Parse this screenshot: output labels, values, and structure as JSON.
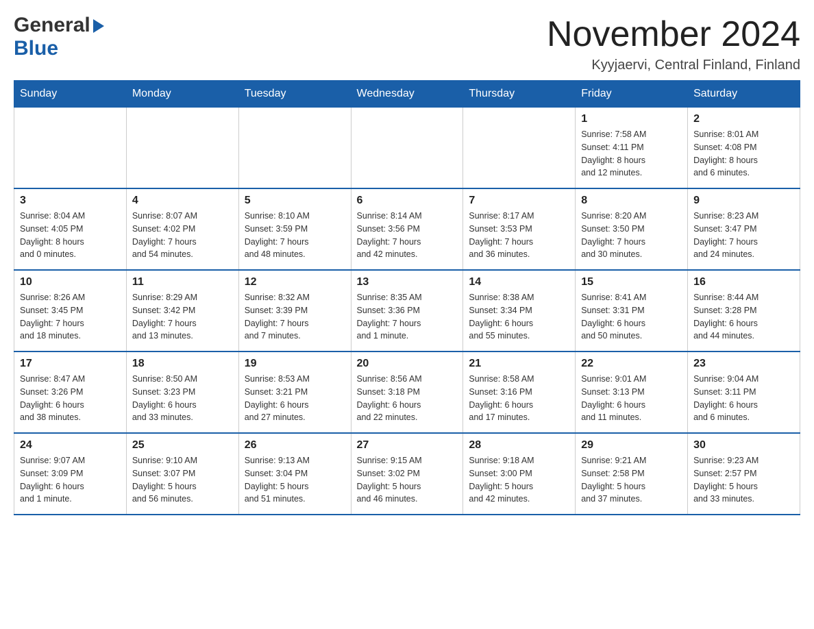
{
  "logo": {
    "general": "General",
    "blue": "Blue"
  },
  "title": "November 2024",
  "location": "Kyyjaervi, Central Finland, Finland",
  "weekdays": [
    "Sunday",
    "Monday",
    "Tuesday",
    "Wednesday",
    "Thursday",
    "Friday",
    "Saturday"
  ],
  "weeks": [
    [
      {
        "day": "",
        "info": ""
      },
      {
        "day": "",
        "info": ""
      },
      {
        "day": "",
        "info": ""
      },
      {
        "day": "",
        "info": ""
      },
      {
        "day": "",
        "info": ""
      },
      {
        "day": "1",
        "info": "Sunrise: 7:58 AM\nSunset: 4:11 PM\nDaylight: 8 hours\nand 12 minutes."
      },
      {
        "day": "2",
        "info": "Sunrise: 8:01 AM\nSunset: 4:08 PM\nDaylight: 8 hours\nand 6 minutes."
      }
    ],
    [
      {
        "day": "3",
        "info": "Sunrise: 8:04 AM\nSunset: 4:05 PM\nDaylight: 8 hours\nand 0 minutes."
      },
      {
        "day": "4",
        "info": "Sunrise: 8:07 AM\nSunset: 4:02 PM\nDaylight: 7 hours\nand 54 minutes."
      },
      {
        "day": "5",
        "info": "Sunrise: 8:10 AM\nSunset: 3:59 PM\nDaylight: 7 hours\nand 48 minutes."
      },
      {
        "day": "6",
        "info": "Sunrise: 8:14 AM\nSunset: 3:56 PM\nDaylight: 7 hours\nand 42 minutes."
      },
      {
        "day": "7",
        "info": "Sunrise: 8:17 AM\nSunset: 3:53 PM\nDaylight: 7 hours\nand 36 minutes."
      },
      {
        "day": "8",
        "info": "Sunrise: 8:20 AM\nSunset: 3:50 PM\nDaylight: 7 hours\nand 30 minutes."
      },
      {
        "day": "9",
        "info": "Sunrise: 8:23 AM\nSunset: 3:47 PM\nDaylight: 7 hours\nand 24 minutes."
      }
    ],
    [
      {
        "day": "10",
        "info": "Sunrise: 8:26 AM\nSunset: 3:45 PM\nDaylight: 7 hours\nand 18 minutes."
      },
      {
        "day": "11",
        "info": "Sunrise: 8:29 AM\nSunset: 3:42 PM\nDaylight: 7 hours\nand 13 minutes."
      },
      {
        "day": "12",
        "info": "Sunrise: 8:32 AM\nSunset: 3:39 PM\nDaylight: 7 hours\nand 7 minutes."
      },
      {
        "day": "13",
        "info": "Sunrise: 8:35 AM\nSunset: 3:36 PM\nDaylight: 7 hours\nand 1 minute."
      },
      {
        "day": "14",
        "info": "Sunrise: 8:38 AM\nSunset: 3:34 PM\nDaylight: 6 hours\nand 55 minutes."
      },
      {
        "day": "15",
        "info": "Sunrise: 8:41 AM\nSunset: 3:31 PM\nDaylight: 6 hours\nand 50 minutes."
      },
      {
        "day": "16",
        "info": "Sunrise: 8:44 AM\nSunset: 3:28 PM\nDaylight: 6 hours\nand 44 minutes."
      }
    ],
    [
      {
        "day": "17",
        "info": "Sunrise: 8:47 AM\nSunset: 3:26 PM\nDaylight: 6 hours\nand 38 minutes."
      },
      {
        "day": "18",
        "info": "Sunrise: 8:50 AM\nSunset: 3:23 PM\nDaylight: 6 hours\nand 33 minutes."
      },
      {
        "day": "19",
        "info": "Sunrise: 8:53 AM\nSunset: 3:21 PM\nDaylight: 6 hours\nand 27 minutes."
      },
      {
        "day": "20",
        "info": "Sunrise: 8:56 AM\nSunset: 3:18 PM\nDaylight: 6 hours\nand 22 minutes."
      },
      {
        "day": "21",
        "info": "Sunrise: 8:58 AM\nSunset: 3:16 PM\nDaylight: 6 hours\nand 17 minutes."
      },
      {
        "day": "22",
        "info": "Sunrise: 9:01 AM\nSunset: 3:13 PM\nDaylight: 6 hours\nand 11 minutes."
      },
      {
        "day": "23",
        "info": "Sunrise: 9:04 AM\nSunset: 3:11 PM\nDaylight: 6 hours\nand 6 minutes."
      }
    ],
    [
      {
        "day": "24",
        "info": "Sunrise: 9:07 AM\nSunset: 3:09 PM\nDaylight: 6 hours\nand 1 minute."
      },
      {
        "day": "25",
        "info": "Sunrise: 9:10 AM\nSunset: 3:07 PM\nDaylight: 5 hours\nand 56 minutes."
      },
      {
        "day": "26",
        "info": "Sunrise: 9:13 AM\nSunset: 3:04 PM\nDaylight: 5 hours\nand 51 minutes."
      },
      {
        "day": "27",
        "info": "Sunrise: 9:15 AM\nSunset: 3:02 PM\nDaylight: 5 hours\nand 46 minutes."
      },
      {
        "day": "28",
        "info": "Sunrise: 9:18 AM\nSunset: 3:00 PM\nDaylight: 5 hours\nand 42 minutes."
      },
      {
        "day": "29",
        "info": "Sunrise: 9:21 AM\nSunset: 2:58 PM\nDaylight: 5 hours\nand 37 minutes."
      },
      {
        "day": "30",
        "info": "Sunrise: 9:23 AM\nSunset: 2:57 PM\nDaylight: 5 hours\nand 33 minutes."
      }
    ]
  ]
}
